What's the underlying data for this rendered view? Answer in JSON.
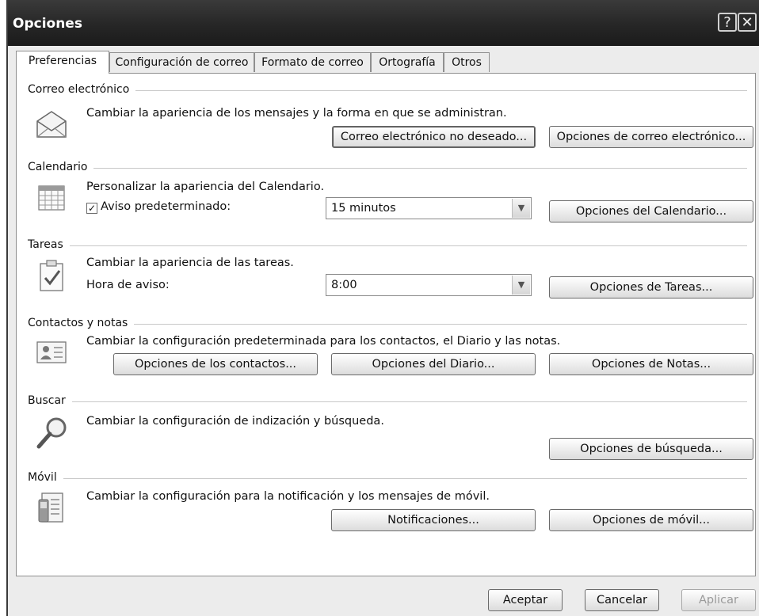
{
  "window": {
    "title": "Opciones",
    "help_glyph": "?",
    "close_glyph": "✕"
  },
  "tabs": [
    {
      "label": "Preferencias"
    },
    {
      "label": "Configuración de correo"
    },
    {
      "label": "Formato de correo"
    },
    {
      "label": "Ortografía"
    },
    {
      "label": "Otros"
    }
  ],
  "sections": {
    "correo": {
      "heading": "Correo electrónico",
      "icon": "envelope-icon",
      "description": "Cambiar la apariencia de los mensajes y la forma en que se administran.",
      "btn_junk": "Correo electrónico no deseado...",
      "btn_options": "Opciones de correo electrónico..."
    },
    "calendario": {
      "heading": "Calendario",
      "icon": "calendar-icon",
      "description": "Personalizar la apariencia del Calendario.",
      "reminder_label": "Aviso predeterminado:",
      "reminder_checked": true,
      "reminder_value": "15 minutos",
      "btn_options": "Opciones del Calendario..."
    },
    "tareas": {
      "heading": "Tareas",
      "icon": "task-clipboard-icon",
      "description": "Cambiar la apariencia de las tareas.",
      "time_label": "Hora de aviso:",
      "time_value": "8:00",
      "btn_options": "Opciones de Tareas..."
    },
    "contactos": {
      "heading": "Contactos y notas",
      "icon": "contact-card-icon",
      "description": "Cambiar la configuración predeterminada para los contactos, el Diario y las notas.",
      "btn_contacts": "Opciones de los contactos...",
      "btn_journal": "Opciones del Diario...",
      "btn_notes": "Opciones de Notas..."
    },
    "buscar": {
      "heading": "Buscar",
      "icon": "magnifier-icon",
      "description": "Cambiar la configuración de indización y búsqueda.",
      "btn_options": "Opciones de búsqueda..."
    },
    "movil": {
      "heading": "Móvil",
      "icon": "mobile-device-icon",
      "description": "Cambiar la configuración para la notificación y los mensajes de móvil.",
      "btn_notifications": "Notificaciones...",
      "btn_options": "Opciones de móvil..."
    }
  },
  "footer": {
    "ok": "Aceptar",
    "cancel": "Cancelar",
    "apply": "Aplicar"
  }
}
